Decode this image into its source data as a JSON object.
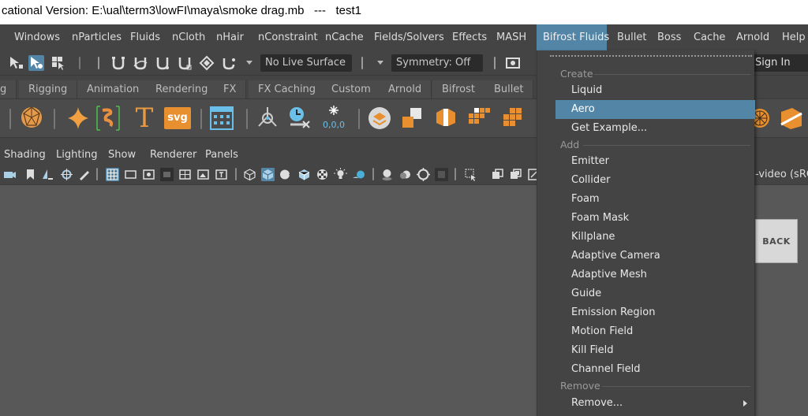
{
  "window": {
    "title": "cational Version: E:\\ual\\term3\\lowFI\\maya\\smoke drag.mb   ---   test1"
  },
  "menubar": {
    "items": [
      "Windows",
      "nParticles",
      "Fluids",
      "nCloth",
      "nHair",
      "nConstraint",
      "nCache",
      "Fields/Solvers",
      "Effects",
      "MASH",
      "Bifrost Fluids",
      "Bullet",
      "Boss",
      "Cache",
      "Arnold",
      "Help"
    ],
    "active": "Bifrost Fluids",
    "accent_color": "#5285a6"
  },
  "statusline": {
    "live_surface": "No Live Surface",
    "symmetry": "Symmetry: Off",
    "sign_in": "Sign In"
  },
  "shelf_tabs": [
    "g",
    "Rigging",
    "Animation",
    "Rendering",
    "FX",
    "FX Caching",
    "Custom",
    "Arnold",
    "Bifrost",
    "Bullet"
  ],
  "shelf": {
    "text_icon": "T",
    "svg_icon": "svg",
    "counter_icon": "0,0,0"
  },
  "panel_menus": [
    "Shading",
    "Lighting",
    "Show",
    "Renderer",
    "Panels"
  ],
  "panel_toolbar": {
    "color_space": "-video (sRG"
  },
  "viewport": {
    "back_button": "BACK"
  },
  "dropdown_menu": {
    "sections": {
      "create": "Create",
      "add": "Add",
      "remove": "Remove"
    },
    "create_items": [
      "Liquid",
      "Aero",
      "Get Example..."
    ],
    "add_items": [
      "Emitter",
      "Collider",
      "Foam",
      "Foam Mask",
      "Killplane",
      "Adaptive Camera",
      "Adaptive Mesh",
      "Guide",
      "Emission Region",
      "Motion Field",
      "Kill Field",
      "Channel Field"
    ],
    "remove_items": [
      "Remove..."
    ],
    "highlighted": "Aero"
  }
}
